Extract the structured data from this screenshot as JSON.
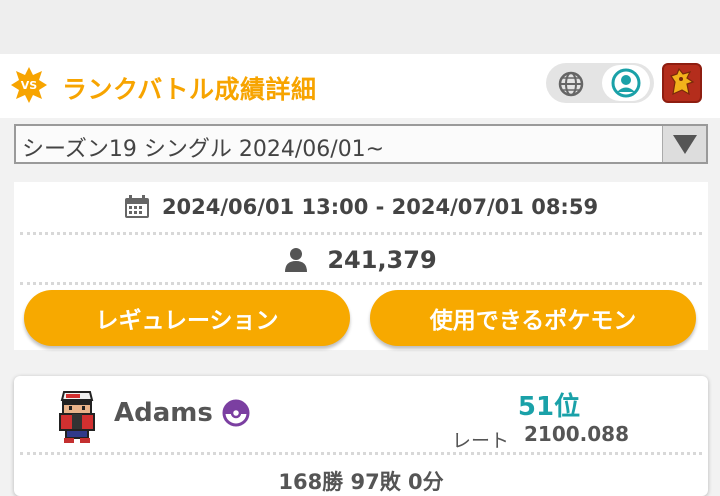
{
  "header": {
    "vs_badge": "VS",
    "title": "ランクバトル成績詳細",
    "icons": {
      "globe": "globe-icon",
      "user": "user-icon",
      "game": "game-icon"
    },
    "accent_color": "#f7a400"
  },
  "season": {
    "selected": "シーズン19 シングル 2024/06/01~"
  },
  "info": {
    "period": "2024/06/01 13:00 - 2024/07/01 08:59",
    "players": "241,379",
    "buttons": {
      "regulation": "レギュレーション",
      "usable_pokemon": "使用できるポケモン"
    }
  },
  "trainer": {
    "name": "Adams",
    "rank": "51位",
    "rate_label": "レート",
    "rate": "2100.088",
    "record": "168勝 97敗 0分",
    "rank_color": "#1aa1a8"
  }
}
